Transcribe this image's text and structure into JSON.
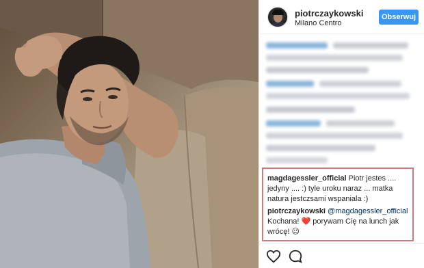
{
  "post": {
    "photo_alt_icon": "portrait-photo",
    "author": {
      "username": "piotrczaykowski",
      "location": "Milano Centro"
    },
    "follow_label": "Obserwuj",
    "comments": [
      {
        "username": "magdagessler_official",
        "mention": "",
        "text": "Piotr jestes .... jedyny .... :) tyle uroku naraz ... matka natura jestczsami wspaniala :)"
      },
      {
        "username": "piotrczaykowski",
        "mention": "@magdagessler_official",
        "text": "Kochana! ❤️ porywam Cię na lunch jak wrócę! 😉"
      }
    ],
    "actions": {
      "like_icon": "heart-icon",
      "comment_icon": "comment-icon"
    }
  },
  "colors": {
    "follow_button": "#3897f0",
    "highlight_border": "#d07b7b",
    "mention": "#003569"
  }
}
